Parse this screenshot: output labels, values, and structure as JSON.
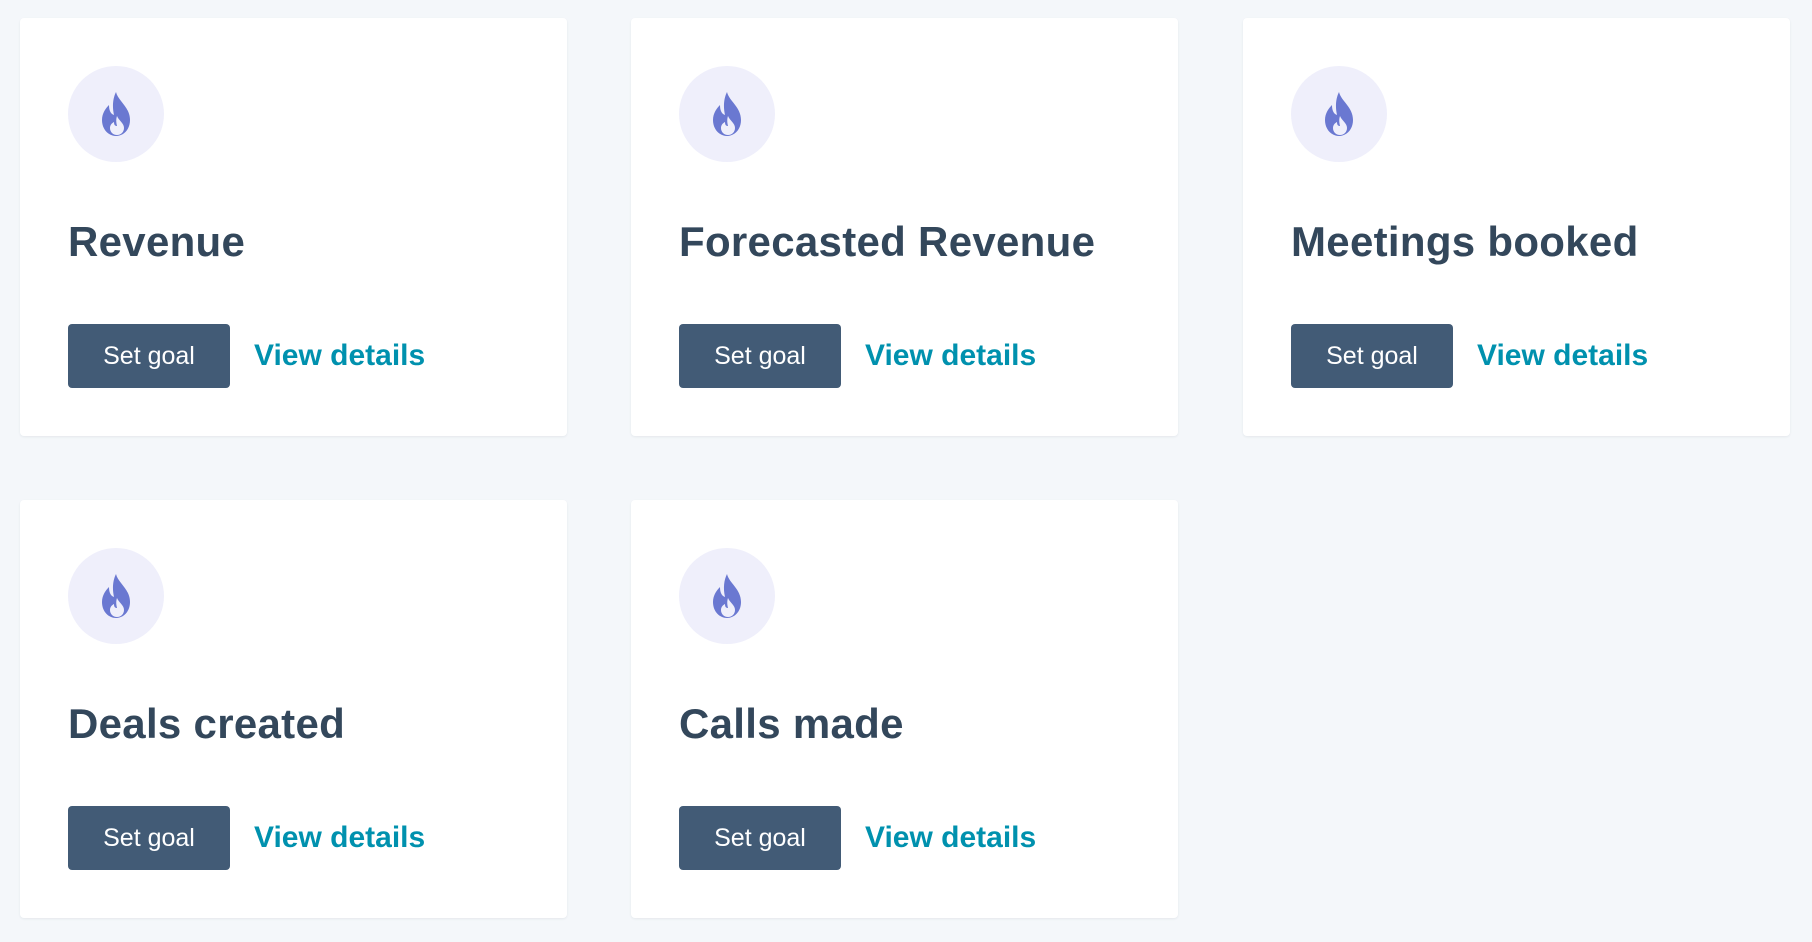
{
  "colors": {
    "page_background": "#f4f7fa",
    "card_background": "#ffffff",
    "title_text": "#33475b",
    "button_background": "#425b76",
    "button_text": "#ffffff",
    "link_text": "#0091ae",
    "icon_circle": "#efeffb",
    "icon_fill": "#6a78d1"
  },
  "cards": [
    {
      "icon": "flame-icon",
      "title": "Revenue",
      "set_goal_label": "Set goal",
      "view_details_label": "View details"
    },
    {
      "icon": "flame-icon",
      "title": "Forecasted Revenue",
      "set_goal_label": "Set goal",
      "view_details_label": "View details"
    },
    {
      "icon": "flame-icon",
      "title": "Meetings booked",
      "set_goal_label": "Set goal",
      "view_details_label": "View details"
    },
    {
      "icon": "flame-icon",
      "title": "Deals created",
      "set_goal_label": "Set goal",
      "view_details_label": "View details"
    },
    {
      "icon": "flame-icon",
      "title": "Calls made",
      "set_goal_label": "Set goal",
      "view_details_label": "View details"
    }
  ]
}
